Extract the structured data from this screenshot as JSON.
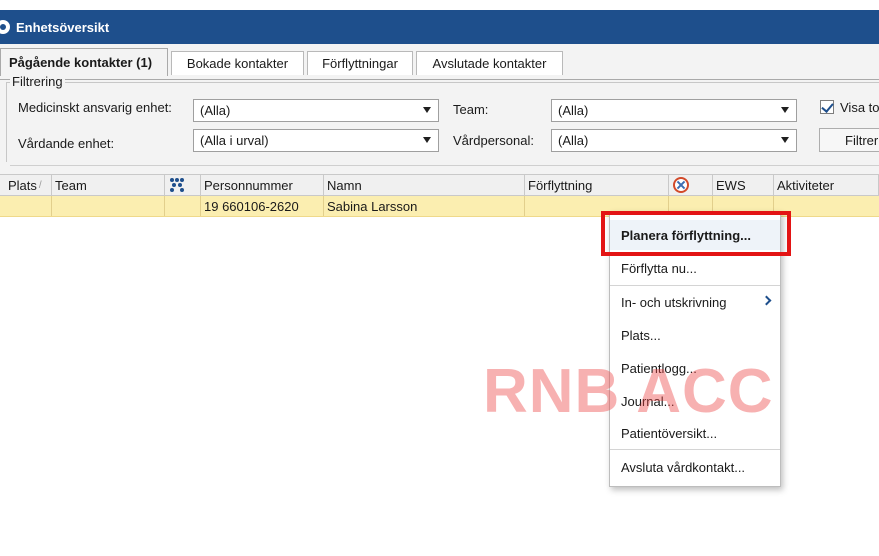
{
  "window": {
    "title": "Enhetsöversikt"
  },
  "tabs": [
    {
      "label": "Pågående kontakter (1)",
      "active": true
    },
    {
      "label": "Bokade kontakter",
      "active": false
    },
    {
      "label": "Förflyttningar",
      "active": false
    },
    {
      "label": "Avslutade kontakter",
      "active": false
    }
  ],
  "filter": {
    "legend": "Filtrering",
    "medical_unit_label": "Medicinskt ansvarig enhet:",
    "medical_unit_value": "(Alla)",
    "care_unit_label": "Vårdande enhet:",
    "care_unit_value": "(Alla i urval)",
    "team_label": "Team:",
    "team_value": "(Alla)",
    "staff_label": "Vårdpersonal:",
    "staff_value": "(Alla)",
    "show_checkbox_label": "Visa to",
    "show_checkbox_checked": true,
    "filter_button_label": "Filtrer"
  },
  "grid": {
    "columns": [
      "Plats",
      "Team",
      "",
      "Personnummer",
      "Namn",
      "Förflyttning",
      "",
      "EWS",
      "Aktiviteter"
    ],
    "sort_indicator": "/",
    "rows": [
      {
        "plats": "",
        "team": "",
        "personnummer": "19 660106-2620",
        "namn": "Sabina Larsson",
        "forflyttning": "",
        "ews": "",
        "aktiviteter": ""
      }
    ],
    "row_highlight_color": "#fbeeb0"
  },
  "context_menu": {
    "items": [
      {
        "label": "Planera förflyttning...",
        "highlighted": true
      },
      {
        "label": "Förflytta nu..."
      },
      {
        "label": "In- och utskrivning",
        "submenu": true
      },
      {
        "label": "Plats..."
      },
      {
        "label": "Patientlogg..."
      },
      {
        "label": "Journal..."
      },
      {
        "label": "Patientöversikt..."
      },
      {
        "label": "Avsluta vårdkontakt..."
      }
    ]
  },
  "annotation": {
    "color": "#e31414"
  },
  "watermark": {
    "text": "RNB ACC",
    "color": "#ec4646"
  },
  "colors": {
    "titlebar": "#1e4f8c",
    "selected_row": "#fbeeb0",
    "panel": "#f3f3f3"
  }
}
